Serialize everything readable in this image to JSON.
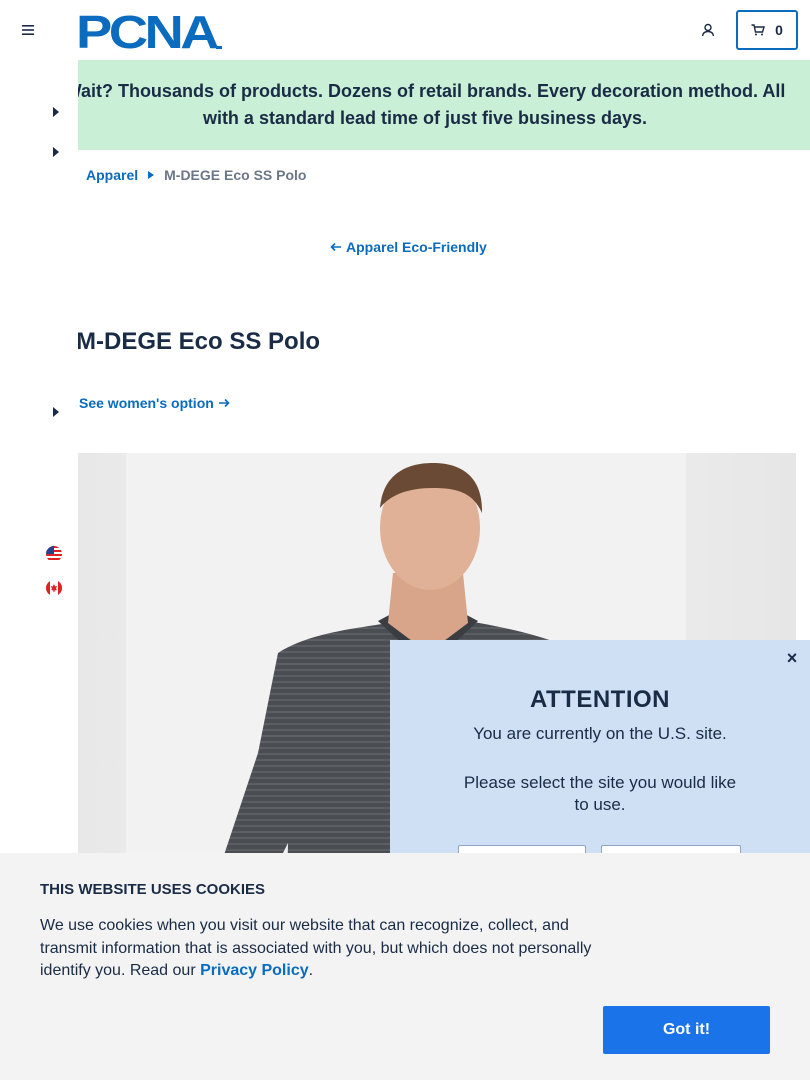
{
  "header": {
    "logo_text": "PCNA",
    "cart_count": "0"
  },
  "banner": {
    "text_line1": "Wait? Thousands of products. Dozens of retail brands. Every decoration method. All",
    "text_line2": "with a standard lead time of just five business days."
  },
  "breadcrumb": {
    "parent": "Apparel",
    "current": "M-DEGE Eco SS Polo"
  },
  "back_link": {
    "label": "Apparel Eco-Friendly"
  },
  "product": {
    "title": "M-DEGE Eco SS Polo",
    "womens_link": "See women's option"
  },
  "left_rail": {
    "flags": [
      "us-flag-icon",
      "canada-flag-icon"
    ]
  },
  "modal": {
    "title": "ATTENTION",
    "line1": "You are currently on the U.S. site.",
    "line2": "Please select the site you would like to use."
  },
  "cookie": {
    "title": "THIS WEBSITE USES COOKIES",
    "text_before": "We use cookies when you visit our website that can recognize, collect, and transmit information that is associated with you, but which does not personally identify you. Read our ",
    "link_label": "Privacy Policy",
    "text_after": ".",
    "button_label": "Got it!"
  },
  "colors": {
    "brand_blue": "#0a6bbf",
    "banner_green": "#c9f0d7",
    "modal_blue": "#cfe0f5",
    "cookie_button": "#1a73e8",
    "text_dark": "#1a2b45"
  }
}
